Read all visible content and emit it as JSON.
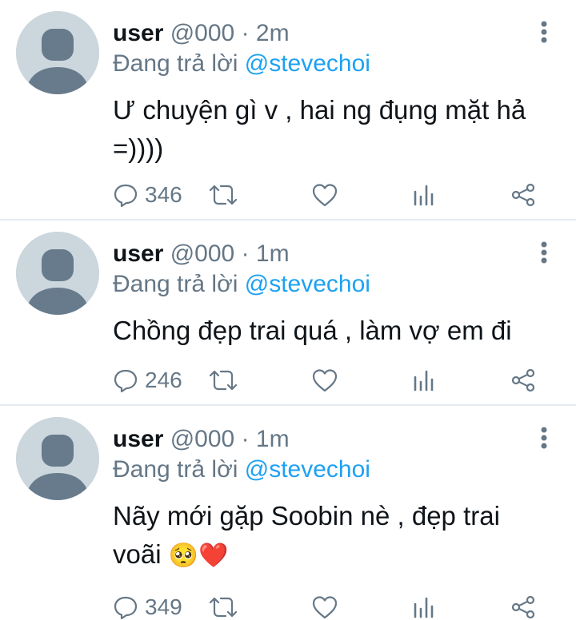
{
  "tweets": [
    {
      "name": "user",
      "handle": "@000",
      "separator": "·",
      "time": "2m",
      "reply_prefix": "Đang trả lời",
      "reply_to": "@stevechoi",
      "text": "Ư chuyện gì v , hai ng đụng mặt hả =))))",
      "reply_count": "346"
    },
    {
      "name": "user",
      "handle": "@000",
      "separator": "·",
      "time": "1m",
      "reply_prefix": "Đang trả lời",
      "reply_to": "@stevechoi",
      "text": "Chồng đẹp trai quá , làm vợ em đi",
      "reply_count": "246"
    },
    {
      "name": "user",
      "handle": "@000",
      "separator": "·",
      "time": "1m",
      "reply_prefix": "Đang trả lời",
      "reply_to": "@stevechoi",
      "text": "Nãy mới gặp Soobin nè , đẹp trai voãi",
      "text_emoji": "🥺❤️",
      "reply_count": "349"
    }
  ],
  "icons": {
    "avatar": "default-avatar-icon",
    "more": "more-vertical-icon",
    "reply": "reply-icon",
    "retweet": "retweet-icon",
    "like": "heart-icon",
    "stats": "analytics-icon",
    "share": "share-icon"
  },
  "colors": {
    "text": "#0f1419",
    "secondary": "#657786",
    "link": "#1da1f2",
    "avatar_bg": "#ccd6dd",
    "avatar_fg": "#687b8c",
    "divider": "#e6ecf0"
  }
}
